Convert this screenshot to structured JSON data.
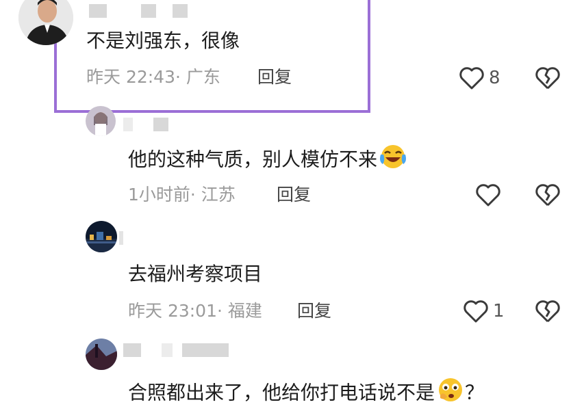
{
  "comments": [
    {
      "text": "不是刘强东，很像",
      "time": "昨天 22:43",
      "location": "· 广东",
      "reply": "回复",
      "likes": "8"
    },
    {
      "text": "他的这种气质，别人模仿不来",
      "time": "1小时前",
      "location": "· 江苏",
      "reply": "回复",
      "likes": ""
    },
    {
      "text": "去福州考察项目",
      "time": "昨天 23:01",
      "location": "· 福建",
      "reply": "回复",
      "likes": "1"
    },
    {
      "text": "合照都出来了，他给你打电话说不是",
      "trailing": "？"
    }
  ],
  "colors": {
    "highlight_border": "#9b6fd6",
    "meta_text": "#9a9a9a"
  },
  "icons": [
    "heart-icon",
    "broken-heart-icon",
    "crying-laughing-emoji",
    "thinking-emoji"
  ]
}
